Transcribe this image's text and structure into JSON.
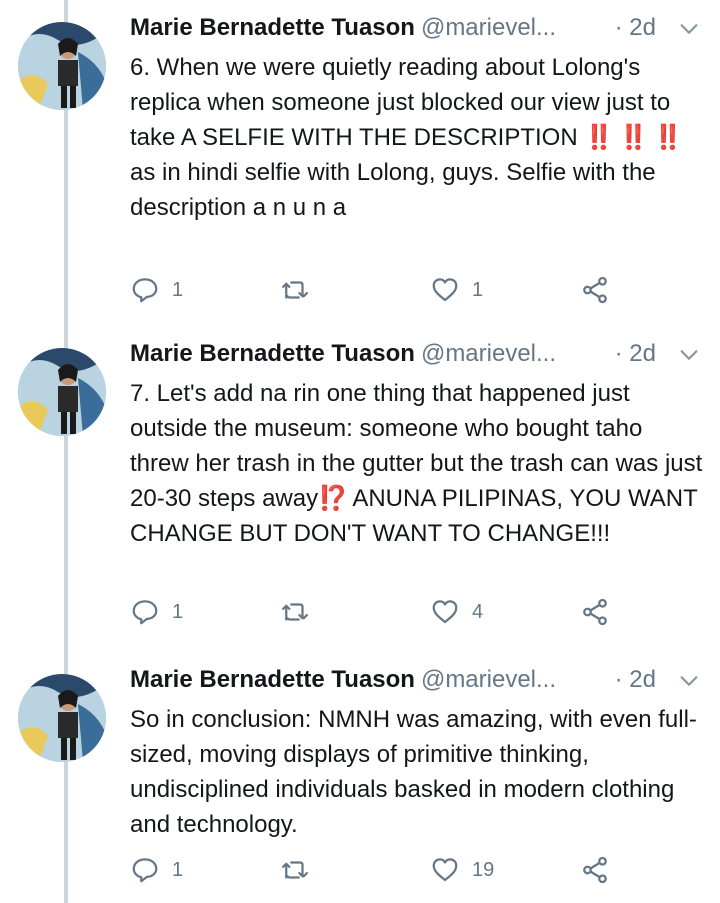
{
  "tweets": [
    {
      "name": "Marie Bernadette Tuason",
      "handle": "@marievel...",
      "time": "· 2d",
      "text_parts": [
        "6. When we were quietly reading about Lolong's replica when someone just blocked our view just to take A SELFIE WITH THE DESCRIPTION ",
        "‼️ ‼️ ‼️",
        " as in hindi selfie with Lolong, guys. Selfie with the description a n u n a"
      ],
      "reply_count": "1",
      "retweet_count": "",
      "like_count": "1"
    },
    {
      "name": "Marie Bernadette Tuason",
      "handle": "@marievel...",
      "time": "· 2d",
      "text_parts": [
        "7. Let's add na rin one thing that happened just outside the museum: someone who bought taho threw her trash in the gutter but the trash can was just 20-30 steps away",
        "⁉️",
        " ANUNA PILIPINAS, YOU WANT CHANGE BUT DON'T WANT TO CHANGE!!!"
      ],
      "reply_count": "1",
      "retweet_count": "",
      "like_count": "4"
    },
    {
      "name": "Marie Bernadette Tuason",
      "handle": "@marievel...",
      "time": "· 2d",
      "text_parts": [
        "So in conclusion: NMNH was amazing, with even full-sized, moving displays of primitive thinking, undisciplined individuals basked in modern clothing and technology.",
        "",
        ""
      ],
      "reply_count": "1",
      "retweet_count": "",
      "like_count": "19"
    }
  ],
  "icons": {
    "reply": "reply-icon",
    "retweet": "retweet-icon",
    "like": "heart-icon",
    "share": "share-icon",
    "caret": "chevron-down-icon"
  },
  "colors": {
    "text": "#14171a",
    "secondary": "#657786",
    "thread_line": "#ccd6dd",
    "emoji_red": "#e0245e"
  }
}
